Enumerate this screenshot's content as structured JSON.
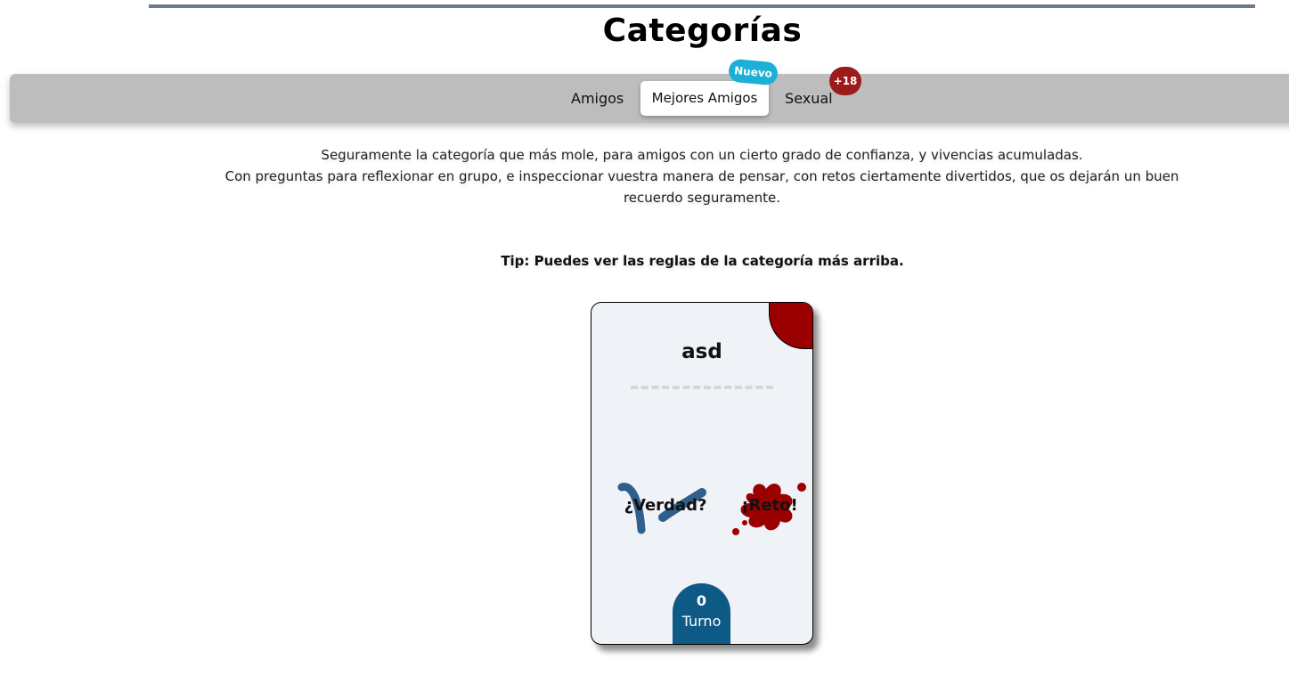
{
  "header": {
    "title": "Categorías"
  },
  "tabs": [
    {
      "label": "Amigos",
      "active": false
    },
    {
      "label": "Mejores Amigos",
      "active": true,
      "badge": "Nuevo"
    },
    {
      "label": "Sexual",
      "active": false,
      "badge": "+18"
    }
  ],
  "description": {
    "line1": "Seguramente la categoría que más mole, para amigos con un cierto grado de confianza, y vivencias acumuladas.",
    "line2": "Con preguntas para reflexionar en grupo, e inspeccionar vuestra manera de pensar, con retos ciertamente divertidos, que os dejarán un buen recuerdo seguramente."
  },
  "tip": "Tip: Puedes ver las reglas de la categoría más arriba.",
  "card": {
    "title": "asd",
    "truth_label": "¿Verdad?",
    "dare_label": "¡Reto!",
    "turn_count": "0",
    "turn_label": "Turno"
  },
  "colors": {
    "tabs_bar": "#bdbdbd",
    "badge_new": "#1cb0d6",
    "badge_adult": "#9b1b1b",
    "card_corner": "#9b0000",
    "turn_box": "#0e5a86",
    "truth_brush": "#2f5f8a",
    "dare_splat": "#9b0000"
  }
}
